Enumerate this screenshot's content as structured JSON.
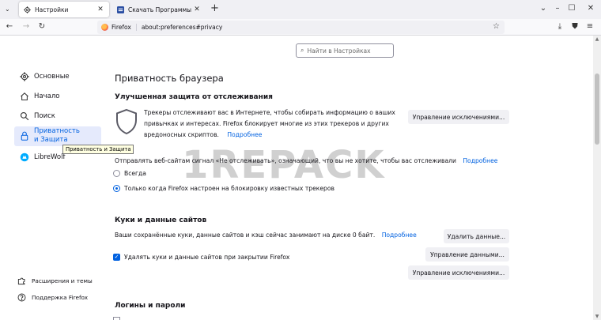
{
  "tabs": [
    {
      "title": "Настройки",
      "icon": "gear-icon",
      "active": true
    },
    {
      "title": "Скачать Программы для компьютера",
      "icon": "site-favicon-icon",
      "active": false
    }
  ],
  "toolbar": {
    "identity_label": "Firefox",
    "url": "about:preferences#privacy"
  },
  "search": {
    "placeholder": "Найти в Настройках"
  },
  "sidebar": {
    "items": [
      {
        "label": "Основные",
        "icon": "gear-icon"
      },
      {
        "label": "Начало",
        "icon": "home-icon"
      },
      {
        "label": "Поиск",
        "icon": "search-icon"
      },
      {
        "label": "Приватность и Защита",
        "icon": "lock-icon",
        "selected": true
      },
      {
        "label": "LibreWolf",
        "icon": "librewolf-icon"
      }
    ],
    "tooltip": "Приватность и Защита",
    "footer": [
      {
        "label": "Расширения и темы",
        "icon": "puzzle-icon"
      },
      {
        "label": "Поддержка Firefox",
        "icon": "help-icon"
      }
    ]
  },
  "main": {
    "title": "Приватность браузера",
    "etp": {
      "heading": "Улучшенная защита от отслеживания",
      "lines": [
        "Трекеры отслеживают вас в Интернете, чтобы собирать информацию о ваших",
        "привычках и интересах. Firefox блокирует многие из этих трекеров и других",
        "вредоносных скриптов."
      ],
      "more_link": "Подробнее",
      "exceptions_button": "Управление исключениями..."
    },
    "dnt": {
      "text": "Отправлять веб-сайтам сигнал «Не отслеживать», означающий, что вы не хотите, чтобы вас отслеживали",
      "more_link": "Подробнее",
      "options": [
        {
          "label": "Всегда",
          "checked": false
        },
        {
          "label": "Только когда Firefox настроен на блокировку известных трекеров",
          "checked": true
        }
      ]
    },
    "cookies": {
      "heading": "Куки и данные сайтов",
      "text": "Ваши сохранённые куки, данные сайтов и кэш сейчас занимают на диске 0 байт.",
      "more_link": "Подробнее",
      "delete_checkbox": "Удалять куки и данные сайтов при закрытии Firefox",
      "delete_checked": true,
      "clear_button": "Удалить данные...",
      "manage_data_button": "Управление данными...",
      "manage_exceptions_button": "Управление исключениями..."
    },
    "logins": {
      "heading": "Логины и пароли"
    }
  },
  "watermark": "1REPACK",
  "colors": {
    "accent": "#0061e0",
    "selected_bg": "#e5eafc",
    "tab_strip": "#f0f0f4",
    "button_bg": "#f0f0f4"
  }
}
